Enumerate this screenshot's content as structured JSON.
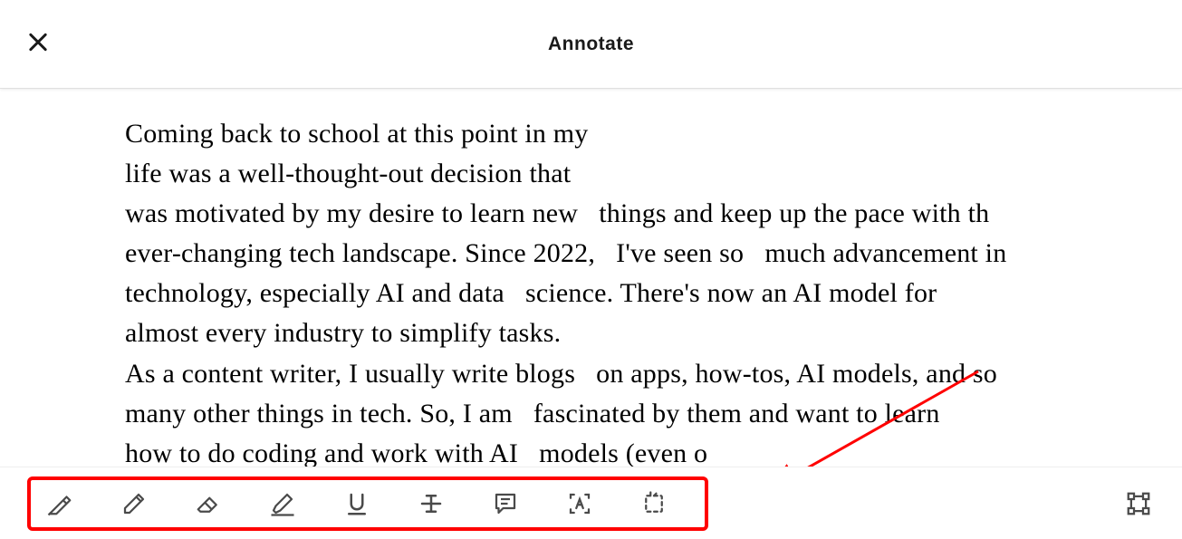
{
  "header": {
    "title": "Annotate"
  },
  "document": {
    "body": "Coming back to school at this point in my\nlife was a well-thought-out decision that\nwas motivated by my desire to learn new   things and keep up the pace with th\never-changing tech landscape. Since 2022,   I've seen so   much advancement in\ntechnology, especially AI and data   science. There's now an AI model for\nalmost every industry to simplify tasks.\nAs a content writer, I usually write blogs   on apps, how-tos, AI models, and so\nmany other things in tech. So, I am   fascinated by them and want to learn\nhow to do coding and work with AI   models (even o"
  },
  "toolbar": {
    "tools": [
      {
        "name": "pen-marker-icon"
      },
      {
        "name": "pen-icon"
      },
      {
        "name": "eraser-icon"
      },
      {
        "name": "highlighter-icon"
      },
      {
        "name": "underline-icon"
      },
      {
        "name": "strikethrough-icon"
      },
      {
        "name": "comment-icon"
      },
      {
        "name": "text-recognition-icon"
      },
      {
        "name": "crop-icon"
      }
    ],
    "right_tool": {
      "name": "shapes-icon"
    }
  },
  "colors": {
    "highlight_border": "#ff0000",
    "text": "#000000",
    "icon": "#4a4a4a"
  }
}
